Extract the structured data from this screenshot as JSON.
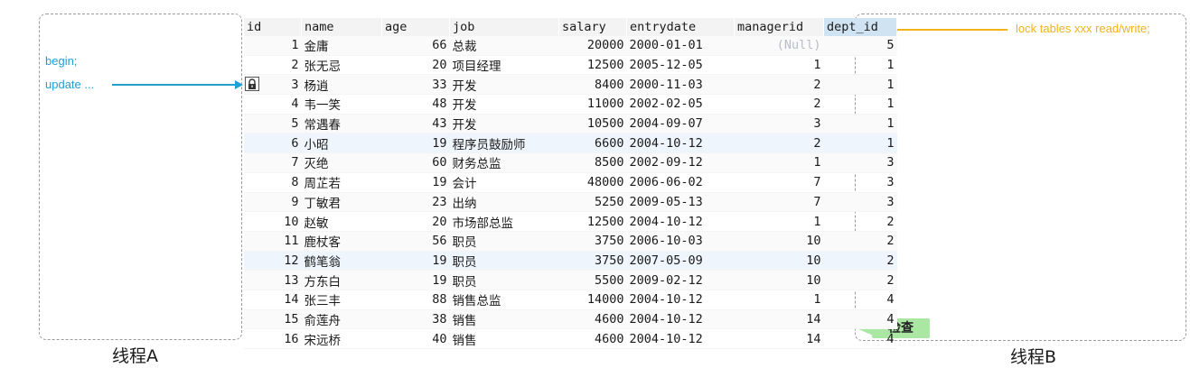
{
  "thread_a": {
    "caption": "线程A",
    "line1": "begin;",
    "line2": "update ..."
  },
  "thread_b": {
    "caption": "线程B",
    "lock_statement": "lock tables xxx read/write;",
    "check_label": "检查"
  },
  "colors": {
    "thread_a_text": "#1ea0d7",
    "lock_text": "#f2b21a",
    "check_badge": "#a9e7a2",
    "selected_header": "#cfe3f3"
  },
  "table": {
    "columns": [
      "id",
      "name",
      "age",
      "job",
      "salary",
      "entrydate",
      "managerid",
      "dept_id"
    ],
    "selected_column": "dept_id",
    "locked_row_icon": "lock-icon",
    "rows": [
      [
        "1",
        "金庸",
        "66",
        "总裁",
        "20000",
        "2000-01-01",
        "(Null)",
        "5"
      ],
      [
        "2",
        "张无忌",
        "20",
        "项目经理",
        "12500",
        "2005-12-05",
        "1",
        "1"
      ],
      [
        "3",
        "杨逍",
        "33",
        "开发",
        "8400",
        "2000-11-03",
        "2",
        "1"
      ],
      [
        "4",
        "韦一笑",
        "48",
        "开发",
        "11000",
        "2002-02-05",
        "2",
        "1"
      ],
      [
        "5",
        "常遇春",
        "43",
        "开发",
        "10500",
        "2004-09-07",
        "3",
        "1"
      ],
      [
        "6",
        "小昭",
        "19",
        "程序员鼓励师",
        "6600",
        "2004-10-12",
        "2",
        "1"
      ],
      [
        "7",
        "灭绝",
        "60",
        "财务总监",
        "8500",
        "2002-09-12",
        "1",
        "3"
      ],
      [
        "8",
        "周芷若",
        "19",
        "会计",
        "48000",
        "2006-06-02",
        "7",
        "3"
      ],
      [
        "9",
        "丁敏君",
        "23",
        "出纳",
        "5250",
        "2009-05-13",
        "7",
        "3"
      ],
      [
        "10",
        "赵敏",
        "20",
        "市场部总监",
        "12500",
        "2004-10-12",
        "1",
        "2"
      ],
      [
        "11",
        "鹿杖客",
        "56",
        "职员",
        "3750",
        "2006-10-03",
        "10",
        "2"
      ],
      [
        "12",
        "鹤笔翁",
        "19",
        "职员",
        "3750",
        "2007-05-09",
        "10",
        "2"
      ],
      [
        "13",
        "方东白",
        "19",
        "职员",
        "5500",
        "2009-02-12",
        "10",
        "2"
      ],
      [
        "14",
        "张三丰",
        "88",
        "销售总监",
        "14000",
        "2004-10-12",
        "1",
        "4"
      ],
      [
        "15",
        "俞莲舟",
        "38",
        "销售",
        "4600",
        "2004-10-12",
        "14",
        "4"
      ],
      [
        "16",
        "宋远桥",
        "40",
        "销售",
        "4600",
        "2004-10-12",
        "14",
        "4"
      ]
    ]
  }
}
